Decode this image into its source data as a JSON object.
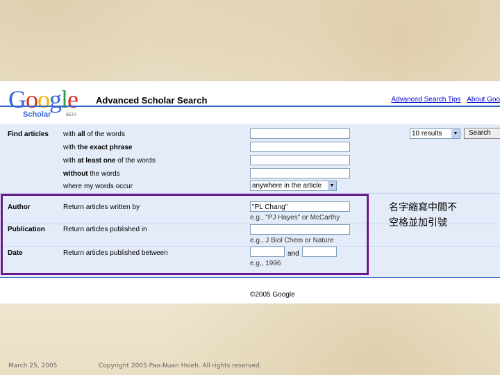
{
  "logo": {
    "text": "Google",
    "sub": "Scholar",
    "badge": "BETA"
  },
  "header": {
    "title": "Advanced Scholar Search",
    "links": [
      "Advanced Search Tips",
      "About Goo"
    ]
  },
  "find": {
    "section_label": "Find articles",
    "rows": [
      {
        "prefix": "with ",
        "bold": "all",
        "suffix": " of the words"
      },
      {
        "prefix": "with ",
        "bold": "the exact phrase",
        "suffix": ""
      },
      {
        "prefix": "with ",
        "bold": "at least one",
        "suffix": " of the words"
      },
      {
        "prefix": "",
        "bold": "without",
        "suffix": " the words"
      },
      {
        "prefix": "where my words occur",
        "bold": "",
        "suffix": ""
      }
    ],
    "occur_select": "anywhere in the article",
    "results_select": "10 results",
    "search_button": "Search"
  },
  "author": {
    "label": "Author",
    "desc": "Return articles written by",
    "value": "\"PL Chang\"",
    "hint": "e.g., \"PJ Hayes\" or McCarthy"
  },
  "publication": {
    "label": "Publication",
    "desc": "Return articles published in",
    "value": "",
    "hint": "e.g., J Biol Chem or Nature"
  },
  "date": {
    "label": "Date",
    "desc": "Return articles published between",
    "from": "",
    "and": "and",
    "to": "",
    "hint": "e.g., 1996"
  },
  "copyright": "©2005 Google",
  "note_lines": [
    "名字縮寫中間不",
    "空格並加引號"
  ],
  "footer": {
    "date": "March 25, 2005",
    "copyright": "Copyright 2005 Pao-Nuan Hsieh. All rights reserved."
  },
  "colors": {
    "annotation_box": "#6b1a8a",
    "form_bg": "#e5ecf9",
    "link": "#0000cc"
  }
}
